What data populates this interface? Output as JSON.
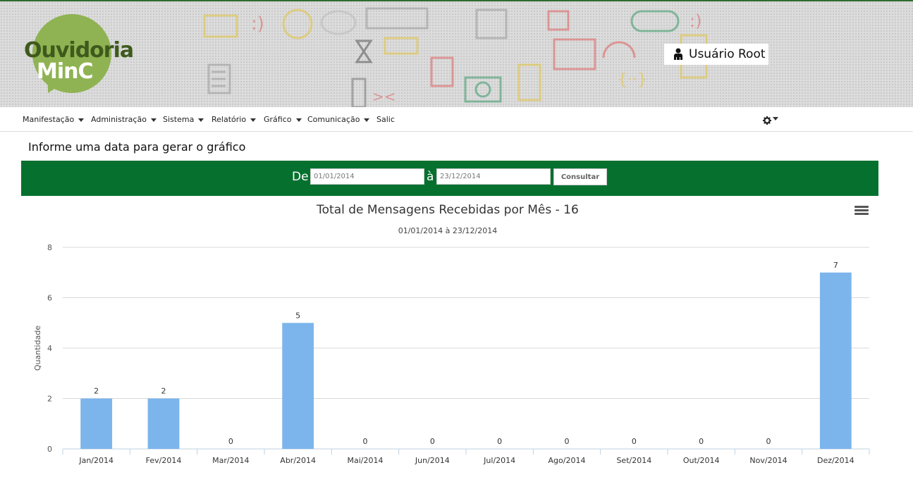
{
  "header": {
    "logo_line1": "Ouvidoria",
    "logo_line2": "MinC",
    "user_icon": "user-icon",
    "user_label": "Usuário Root"
  },
  "nav": {
    "items": [
      {
        "label": "Manifestação",
        "dropdown": true
      },
      {
        "label": "Administração",
        "dropdown": true
      },
      {
        "label": "Sistema",
        "dropdown": true
      },
      {
        "label": "Relatório",
        "dropdown": true
      },
      {
        "label": "Gráfico",
        "dropdown": true
      },
      {
        "label": "Comunicação",
        "dropdown": true
      },
      {
        "label": "Salic",
        "dropdown": false
      }
    ],
    "settings_icon": "gear-icon"
  },
  "page": {
    "heading": "Informe uma data para gerar o gráfico"
  },
  "filter": {
    "from_label": "De",
    "from_value": "01/01/2014",
    "to_label": "à",
    "to_value": "23/12/2014",
    "submit_label": "Consultar"
  },
  "colors": {
    "header_green": "#8fb352",
    "filter_bar": "#06712f",
    "bar_fill": "#7cb5ec"
  },
  "chart_data": {
    "type": "bar",
    "title": "Total de Mensagens Recebidas por Mês - 16",
    "subtitle": "01/01/2014 à 23/12/2014",
    "xlabel": "",
    "ylabel": "Quantidade",
    "categories": [
      "Jan/2014",
      "Fev/2014",
      "Mar/2014",
      "Abr/2014",
      "Mai/2014",
      "Jun/2014",
      "Jul/2014",
      "Ago/2014",
      "Set/2014",
      "Out/2014",
      "Nov/2014",
      "Dez/2014"
    ],
    "values": [
      2,
      2,
      0,
      5,
      0,
      0,
      0,
      0,
      0,
      0,
      0,
      7
    ],
    "ylim": [
      0,
      8
    ],
    "yticks": [
      0,
      2,
      4,
      6,
      8
    ],
    "grid": true,
    "legend": "none",
    "menu_icon": "hamburger-menu-icon"
  }
}
